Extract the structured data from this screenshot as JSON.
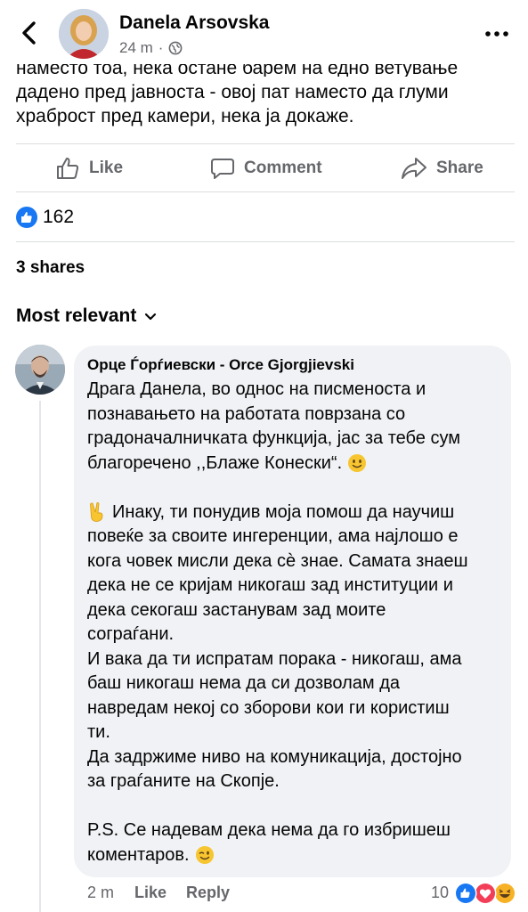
{
  "header": {
    "author": "Danela Arsovska",
    "time": "24 m",
    "dot": "·"
  },
  "post": {
    "lines_partial": "наместо тоа, нека остане барем на едно ветување",
    "lines": [
      "дадено пред јавноста - овој пат наместо да глуми",
      "храброст пред камери, нека ја докаже."
    ]
  },
  "actions": {
    "like": "Like",
    "comment": "Comment",
    "share": "Share"
  },
  "reactions": {
    "count": "162"
  },
  "shares": "3 shares",
  "sort": {
    "label": "Most relevant"
  },
  "comment": {
    "author": "Орце Ѓорѓиевски - Orce Gjorgjievski",
    "paragraph1": [
      "Драга Данела, во однос на писменоста и",
      "познавањето на работата поврзана со",
      "градоначалничката функција, јас за тебе сум",
      "благоречено ,,Блаже Конески“."
    ],
    "paragraph2": [
      "Инаку, ти понудив моја помош да научиш",
      "повеќе за своите ингеренции, ама најлошо е",
      "кога човек мисли дека сѐ знае. Самата знаеш",
      "дека не се криjам никогаш зад институции и",
      "дека секогаш застанувам зад моите",
      "сограѓани.",
      "И вака да ти испратам порака - никогаш, ама",
      "баш никогаш нема да си дозволам да",
      "навредам некој со зборови кои ги користиш",
      "ти.",
      "Да задржиме ниво на комуникација, достојно",
      "за граѓаните на Скопје."
    ],
    "paragraph3": [
      "P.S. Се надевам дека нема да го избришеш",
      "коментаров."
    ],
    "time": "2 m",
    "like": "Like",
    "reply": "Reply",
    "reaction_count": "10",
    "reaction_icons": [
      "like-icon",
      "love-icon",
      "haha-icon"
    ]
  },
  "colors": {
    "accent": "#1877f2",
    "muted": "#65676b",
    "bubble": "#f0f2f5",
    "love": "#f33e58",
    "haha": "#f7b125"
  }
}
